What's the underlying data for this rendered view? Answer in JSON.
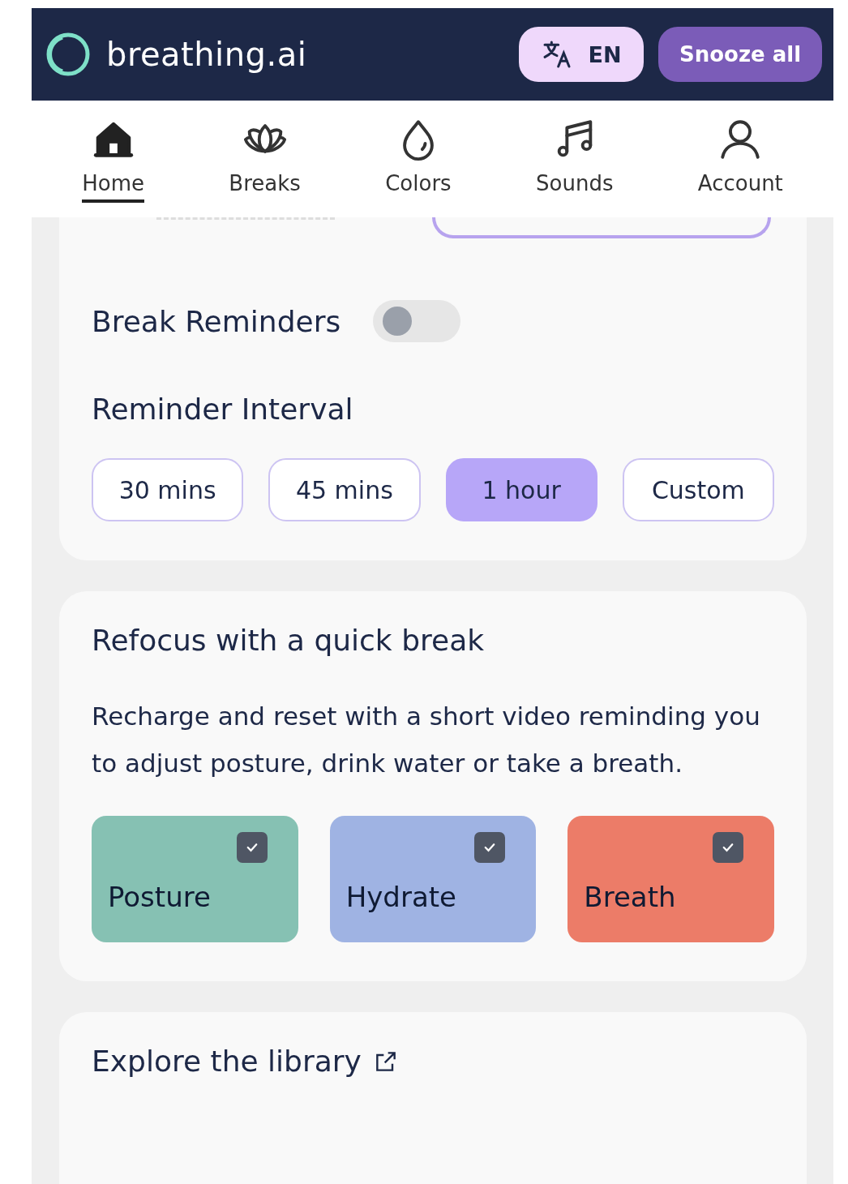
{
  "header": {
    "logo_text": "breathing.ai",
    "language": "EN",
    "snooze_button": "Snooze all"
  },
  "nav": [
    {
      "label": "Home",
      "kind": "home",
      "selected": true
    },
    {
      "label": "Breaks",
      "kind": "breaks",
      "selected": false
    },
    {
      "label": "Colors",
      "kind": "colors",
      "selected": false
    },
    {
      "label": "Sounds",
      "kind": "sounds",
      "selected": false
    },
    {
      "label": "Account",
      "kind": "account",
      "selected": false
    }
  ],
  "reminders": {
    "title": "Break Reminders",
    "on": false,
    "interval_title": "Reminder Interval",
    "intervals": [
      {
        "label": "30 mins",
        "selected": false
      },
      {
        "label": "45 mins",
        "selected": false
      },
      {
        "label": "1 hour",
        "selected": true
      },
      {
        "label": "Custom",
        "selected": false
      }
    ]
  },
  "quick_break": {
    "title": "Refocus with a quick break",
    "description": "Recharge and reset with a short video reminding you to adjust posture, drink water or take a breath.",
    "options": [
      {
        "label": "Posture",
        "color": "#86c1b3",
        "checked": true
      },
      {
        "label": "Hydrate",
        "color": "#9fb3e3",
        "checked": true
      },
      {
        "label": "Breath",
        "color": "#ec7c68",
        "checked": true
      }
    ]
  },
  "library": {
    "title": "Explore the library"
  }
}
